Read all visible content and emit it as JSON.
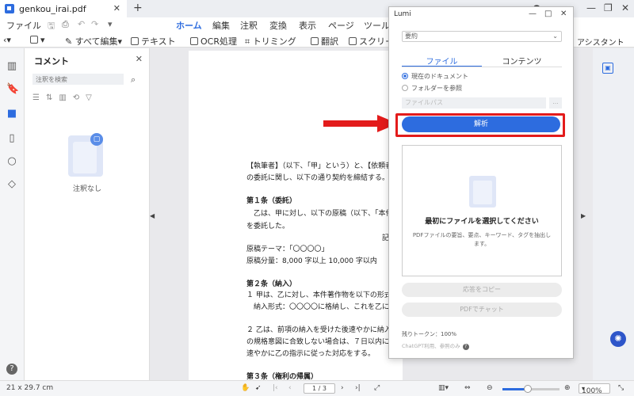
{
  "tab": {
    "filename": "genkou_irai.pdf"
  },
  "menu": {
    "file": "ファイル",
    "items": [
      "ホーム",
      "編集",
      "注釈",
      "変換",
      "表示",
      "ページ",
      "ツール"
    ]
  },
  "toolbar": {
    "edit_all": "すべて編集",
    "text": "テキスト",
    "ocr": "OCR処理",
    "trim": "トリミング",
    "translate": "翻訳",
    "screenshot": "スクリー",
    "assistant": "アシスタント"
  },
  "comments": {
    "title": "コメント",
    "search_placeholder": "注釈を検索",
    "empty": "注釈なし"
  },
  "document": {
    "lines": [
      {
        "text": "【執筆者】（以下、「甲」という）と、【依頼者",
        "bold": false
      },
      {
        "text": "の委託に関し、以下の通り契約を締結する。",
        "bold": false
      },
      {
        "text": "第１条（委託）",
        "bold": true
      },
      {
        "text": "　乙は、甲に対し、以下の原稿（以下、「本件",
        "bold": false
      },
      {
        "text": "を委託した。",
        "bold": false
      },
      {
        "text": "記",
        "bold": false
      },
      {
        "text": "原稿テーマ：「〇〇〇〇」",
        "bold": false
      },
      {
        "text": "原稿分量：8,000 字以上 10,000 字以内",
        "bold": false
      },
      {
        "text": "第２条（納入）",
        "bold": true
      },
      {
        "text": "１ 甲は、乙に対し、本件著作物を以下の形式",
        "bold": false
      },
      {
        "text": "　納入形式：〇〇〇〇に格納し、これを乙に",
        "bold": false
      },
      {
        "text": "２ 乙は、前項の納入を受けた後速やかに納入",
        "bold": false
      },
      {
        "text": "の規格意図に合致しない場合は、７日以内に",
        "bold": false
      },
      {
        "text": "速やかに乙の指示に従った対応をする。",
        "bold": false
      },
      {
        "text": "第３条（権利の帰属）",
        "bold": true
      }
    ]
  },
  "lumi": {
    "title": "Lumi",
    "mode": "要約",
    "tabs": [
      "ファイル",
      "コンテンツ"
    ],
    "radio_current": "現在のドキュメント",
    "radio_folder": "フォルダーを参照",
    "file_placeholder": "ファイルパス",
    "analyze": "解析",
    "drop_title": "最初にファイルを選択してください",
    "drop_desc": "PDFファイルの要旨、要点、キーワード、タグを抽出します。",
    "copy_answer": "応答をコピー",
    "chat_pdf": "PDFでチャット",
    "tokens": "残りトークン：100%",
    "note": "ChatGPT利用、参照のみ"
  },
  "status": {
    "page_size": "21 x 29.7 cm",
    "page": "1 / 3",
    "zoom": "100%",
    "zoom_value": 0.45
  },
  "colors": {
    "accent": "#2d6cdf",
    "highlight": "#e31b1b"
  }
}
